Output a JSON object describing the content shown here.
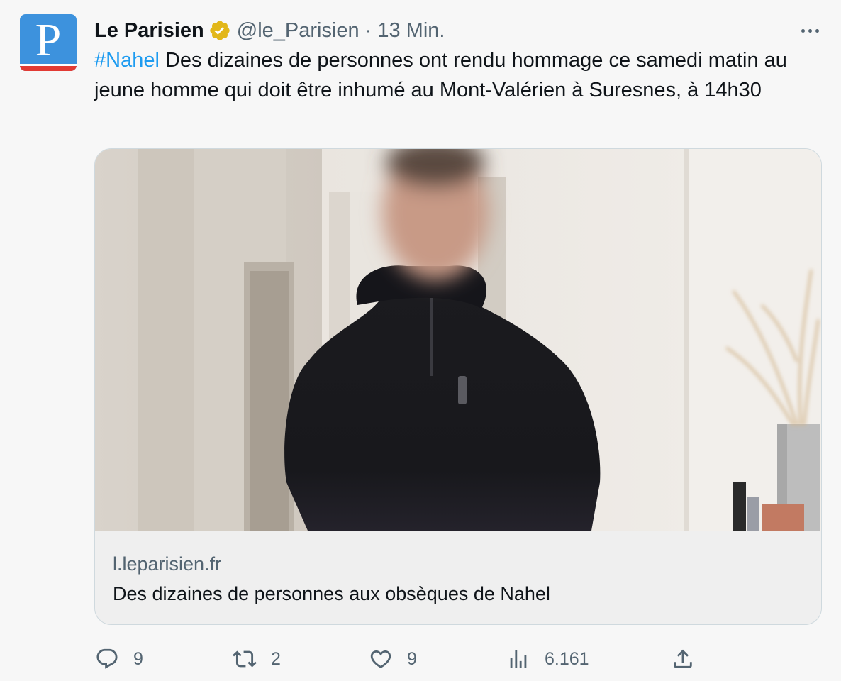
{
  "author": {
    "avatar_letter": "P",
    "name": "Le Parisien",
    "handle": "@le_Parisien",
    "separator": "·",
    "time": "13 Min.",
    "verified_badge": "gold-verified-icon"
  },
  "tweet": {
    "hashtag": "#Nahel",
    "text": " Des dizaines de personnes ont rendu hommage ce samedi matin au jeune homme qui doit être inhumé au Mont-Valérien à Suresnes, à 14h30"
  },
  "card": {
    "domain": "l.leparisien.fr",
    "title": "Des dizaines de personnes aux obsèques de Nahel"
  },
  "actions": {
    "replies": "9",
    "retweets": "2",
    "likes": "9",
    "views": "6.161"
  },
  "colors": {
    "accent": "#1d9bf0",
    "muted": "#536471",
    "avatar_blue": "#3d92dd",
    "avatar_red": "#e23b34",
    "verified_gold": "#e2b719"
  }
}
